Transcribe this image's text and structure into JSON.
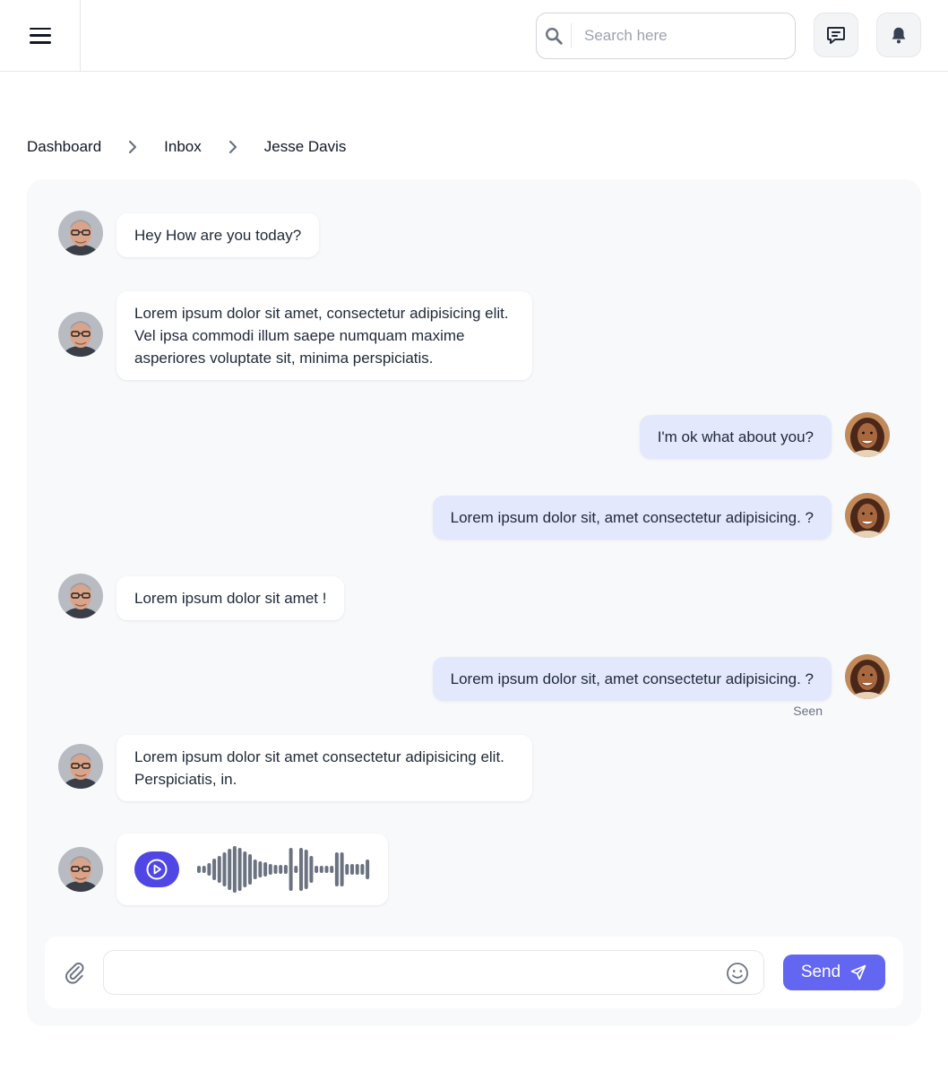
{
  "header": {
    "search_placeholder": "Search here",
    "menu_icon": "hamburger-icon",
    "messages_icon": "chat-message-icon",
    "notifications_icon": "bell-icon"
  },
  "breadcrumb": {
    "items": [
      "Dashboard",
      "Inbox",
      "Jesse Davis"
    ]
  },
  "messages": [
    {
      "from": "contact",
      "text": "Hey How are you today?"
    },
    {
      "from": "contact",
      "text": "Lorem ipsum dolor sit amet, consectetur adipisicing elit. Vel ipsa commodi illum saepe numquam maxime asperiores voluptate sit, minima perspiciatis."
    },
    {
      "from": "me",
      "text": "I'm ok what about you?"
    },
    {
      "from": "me",
      "text": "Lorem ipsum dolor sit, amet consectetur adipisicing. ?"
    },
    {
      "from": "contact",
      "text": "Lorem ipsum dolor sit amet !"
    },
    {
      "from": "me",
      "text": "Lorem ipsum dolor sit, amet consectetur adipisicing. ?",
      "status": "Seen"
    },
    {
      "from": "contact",
      "text": "Lorem ipsum dolor sit amet consectetur adipisicing elit. Perspiciatis, in."
    },
    {
      "from": "contact",
      "type": "voice"
    }
  ],
  "composer": {
    "placeholder": "",
    "send_label": "Send"
  },
  "colors": {
    "accent": "#6366f1",
    "play_button": "#4f46e5",
    "outgoing_bubble": "#e3e8fc",
    "incoming_bubble": "#ffffff",
    "panel_bg": "#f8f9fb"
  }
}
